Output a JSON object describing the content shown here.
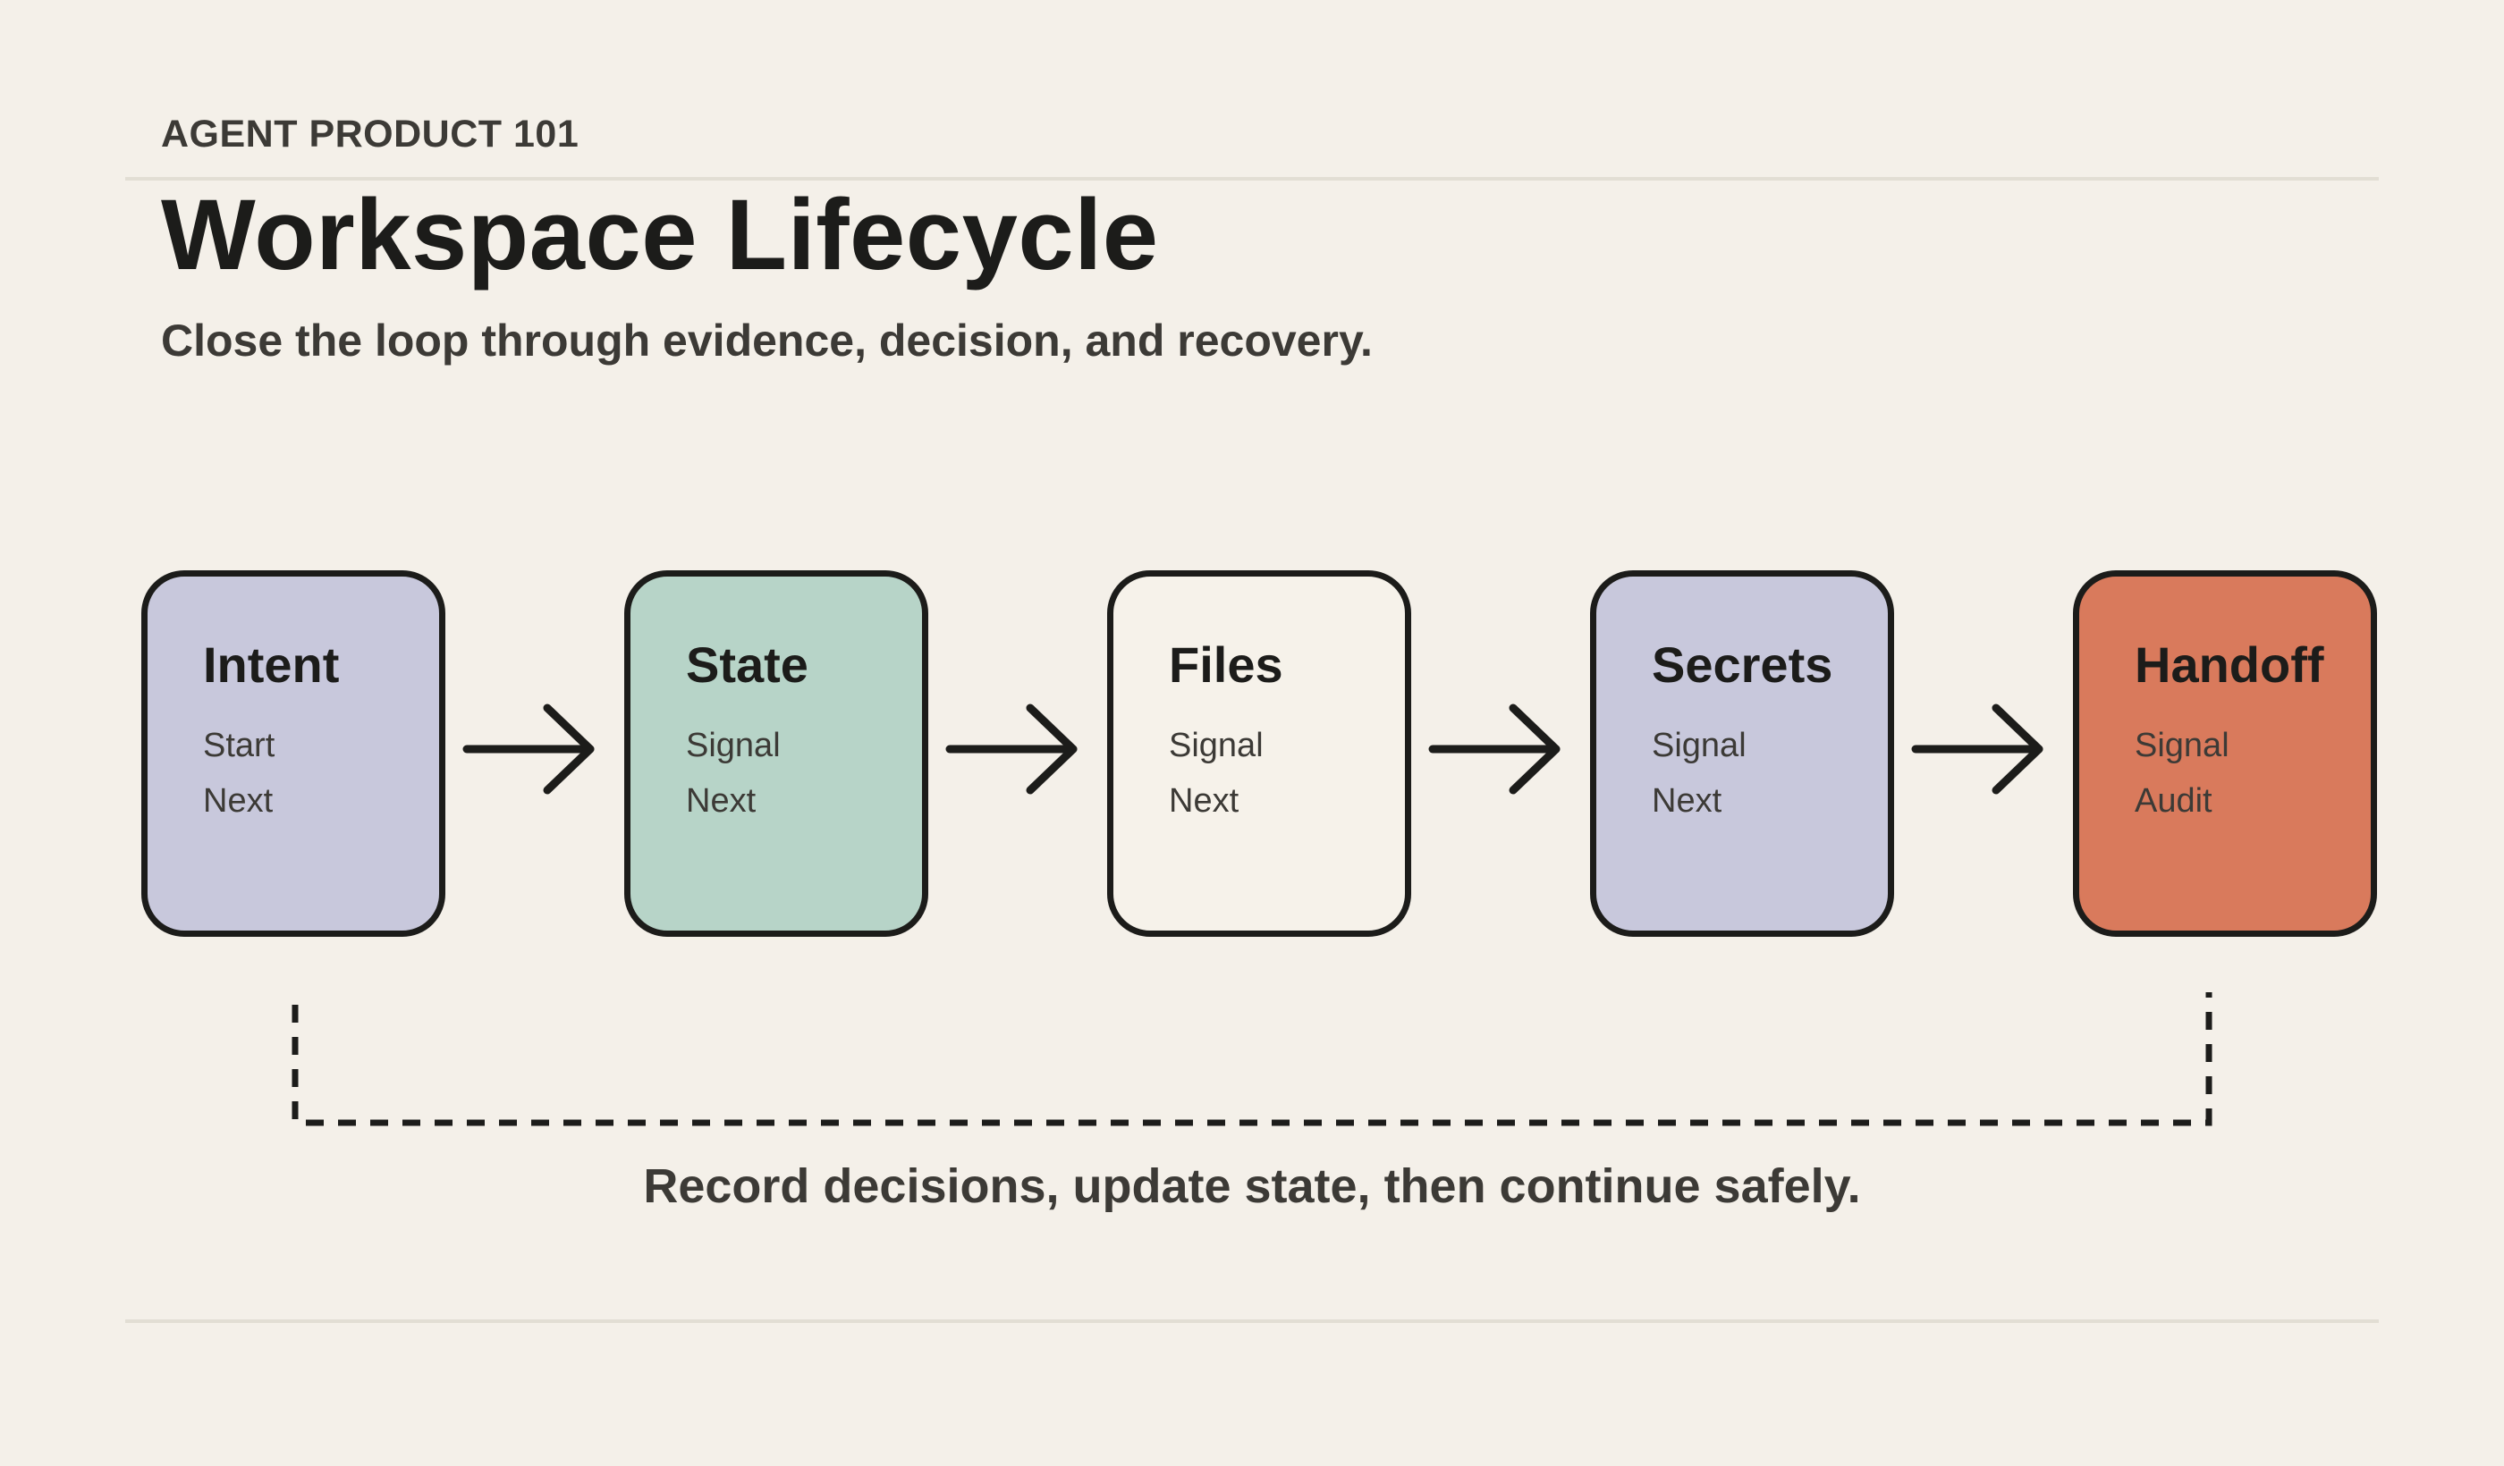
{
  "header": {
    "eyebrow": "AGENT PRODUCT 101",
    "title": "Workspace Lifecycle",
    "subtitle": "Close the loop through evidence, decision, and recovery."
  },
  "nodes": [
    {
      "title": "Intent",
      "lines": [
        "Start",
        "Next"
      ],
      "color": "#c8c8dc"
    },
    {
      "title": "State",
      "lines": [
        "Signal",
        "Next"
      ],
      "color": "#b7d4c8"
    },
    {
      "title": "Files",
      "lines": [
        "Signal",
        "Next"
      ],
      "color": "#f6f2ea"
    },
    {
      "title": "Secrets",
      "lines": [
        "Signal",
        "Next"
      ],
      "color": "#c8c8dc"
    },
    {
      "title": "Handoff",
      "lines": [
        "Signal",
        "Audit"
      ],
      "color": "#d97a5c"
    }
  ],
  "loop": {
    "caption": "Record decisions, update state, then continue safely."
  },
  "colors": {
    "background": "#f4f0e9",
    "ink": "#1c1c1a",
    "muted_text": "#3c3a36",
    "rule": "#e2ded4"
  }
}
